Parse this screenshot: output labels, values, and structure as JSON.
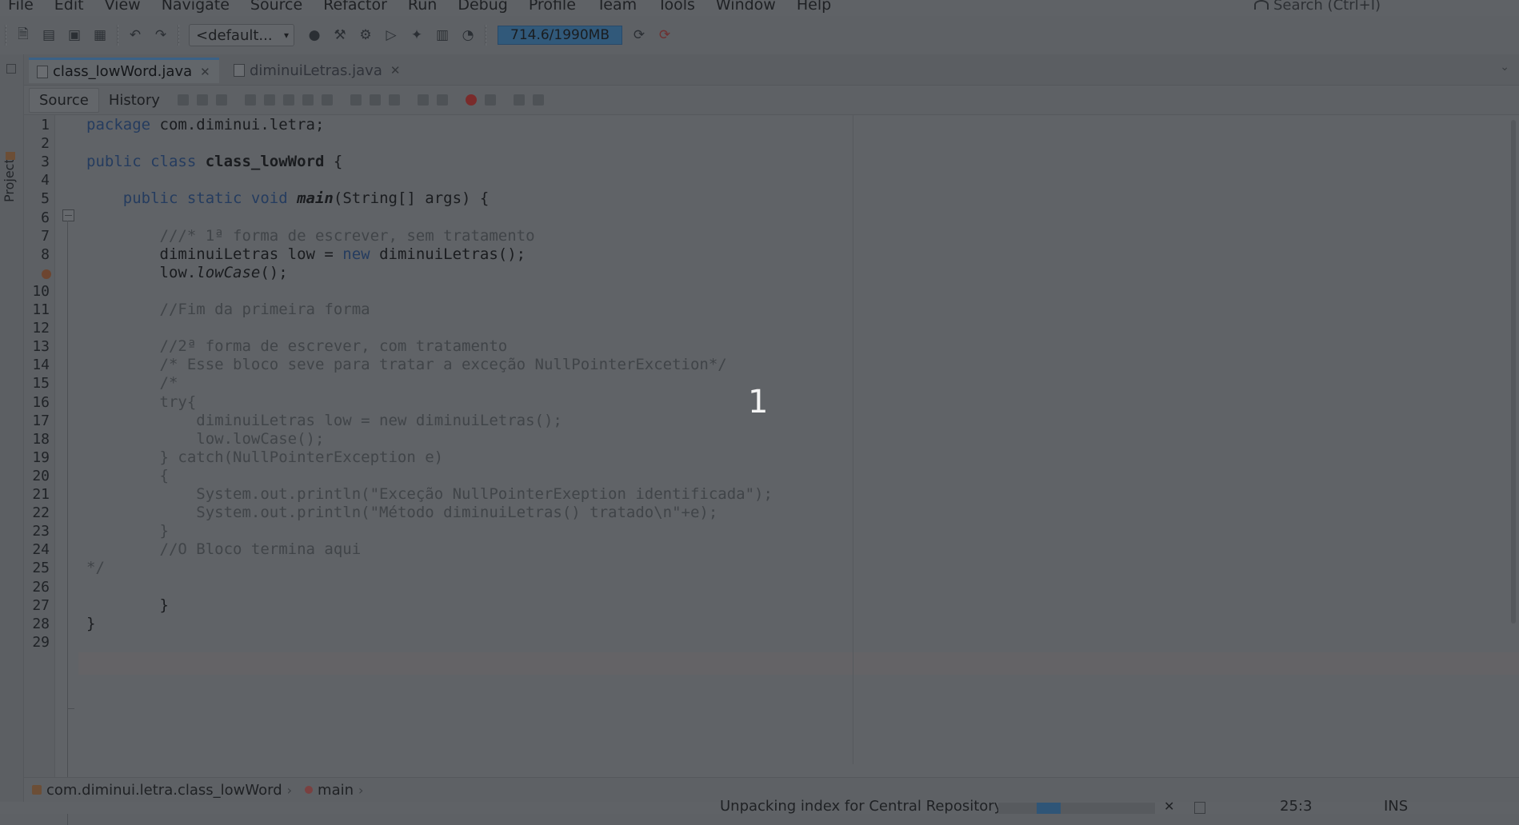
{
  "menu": [
    "File",
    "Edit",
    "View",
    "Navigate",
    "Source",
    "Refactor",
    "Run",
    "Debug",
    "Profile",
    "Team",
    "Tools",
    "Window",
    "Help"
  ],
  "search": {
    "placeholder": "Search (Ctrl+I)"
  },
  "toolbar": {
    "config": "<default...",
    "memory": "714.6/1990MB"
  },
  "sidebar": {
    "projects_label": "Projects"
  },
  "tabs": [
    {
      "label": "class_lowWord.java",
      "active": true
    },
    {
      "label": "diminuiLetras.java",
      "active": false
    }
  ],
  "editor_tabs": {
    "source": "Source",
    "history": "History"
  },
  "code": {
    "lines": [
      {
        "n": "1",
        "t": [
          [
            "kw",
            "package"
          ],
          [
            "txt",
            " com.diminui.letra;"
          ]
        ]
      },
      {
        "n": "2",
        "t": []
      },
      {
        "n": "3",
        "t": [
          [
            "kw",
            "public class "
          ],
          [
            "txt bold",
            "class_lowWord"
          ],
          [
            "txt",
            " {"
          ]
        ]
      },
      {
        "n": "4",
        "t": []
      },
      {
        "n": "5",
        "t": [
          [
            "txt",
            "    "
          ],
          [
            "kw",
            "public static void "
          ],
          [
            "txt bold ital",
            "main"
          ],
          [
            "txt",
            "(String[] args) {"
          ]
        ]
      },
      {
        "n": "6",
        "t": []
      },
      {
        "n": "7",
        "t": [
          [
            "txt",
            "        "
          ],
          [
            "cm",
            "///* 1ª forma de escrever, sem tratamento"
          ]
        ]
      },
      {
        "n": "8",
        "t": [
          [
            "txt",
            "        diminuiLetras low = "
          ],
          [
            "kw",
            "new"
          ],
          [
            "txt",
            " diminuiLetras();"
          ]
        ]
      },
      {
        "n": "",
        "t": [
          [
            "txt",
            "        low."
          ],
          [
            "txt ital",
            "lowCase"
          ],
          [
            "txt",
            "();"
          ]
        ],
        "warn": true
      },
      {
        "n": "10",
        "t": []
      },
      {
        "n": "11",
        "t": [
          [
            "txt",
            "        "
          ],
          [
            "cm",
            "//Fim da primeira forma"
          ]
        ]
      },
      {
        "n": "12",
        "t": []
      },
      {
        "n": "13",
        "t": [
          [
            "txt",
            "        "
          ],
          [
            "cm",
            "//2ª forma de escrever, com tratamento"
          ]
        ]
      },
      {
        "n": "14",
        "t": [
          [
            "txt",
            "        "
          ],
          [
            "cm",
            "/* Esse bloco seve para tratar a exceção NullPointerExcetion*/"
          ]
        ]
      },
      {
        "n": "15",
        "t": [
          [
            "txt",
            "        "
          ],
          [
            "cm",
            "/*"
          ]
        ]
      },
      {
        "n": "16",
        "t": [
          [
            "txt",
            "        "
          ],
          [
            "cm",
            "try{"
          ]
        ]
      },
      {
        "n": "17",
        "t": [
          [
            "txt",
            "            "
          ],
          [
            "cm",
            "diminuiLetras low = new diminuiLetras();"
          ]
        ]
      },
      {
        "n": "18",
        "t": [
          [
            "txt",
            "            "
          ],
          [
            "cm",
            "low.lowCase();"
          ]
        ]
      },
      {
        "n": "19",
        "t": [
          [
            "txt",
            "        "
          ],
          [
            "cm",
            "} catch(NullPointerException e)"
          ]
        ]
      },
      {
        "n": "20",
        "t": [
          [
            "txt",
            "        "
          ],
          [
            "cm",
            "{"
          ]
        ]
      },
      {
        "n": "21",
        "t": [
          [
            "txt",
            "            "
          ],
          [
            "cm",
            "System.out.println(\"Exceção NullPointerExeption identificada\");"
          ]
        ]
      },
      {
        "n": "22",
        "t": [
          [
            "txt",
            "            "
          ],
          [
            "cm",
            "System.out.println(\"Método diminuiLetras() tratado\\n\"+e);"
          ]
        ]
      },
      {
        "n": "23",
        "t": [
          [
            "txt",
            "        "
          ],
          [
            "cm",
            "}"
          ]
        ]
      },
      {
        "n": "24",
        "t": [
          [
            "txt",
            "        "
          ],
          [
            "cm",
            "//O Bloco termina aqui"
          ]
        ]
      },
      {
        "n": "25",
        "t": [
          [
            "cm",
            "*/"
          ]
        ]
      },
      {
        "n": "26",
        "t": []
      },
      {
        "n": "27",
        "t": [
          [
            "txt",
            "        }"
          ]
        ]
      },
      {
        "n": "28",
        "t": [
          [
            "txt",
            "}"
          ]
        ]
      },
      {
        "n": "29",
        "t": []
      }
    ]
  },
  "overlay": {
    "number": "1"
  },
  "breadcrumb": {
    "class_path": "com.diminui.letra.class_lowWord",
    "method": "main"
  },
  "status": {
    "message": "Unpacking index for Central Repository",
    "progress": 0.18,
    "position": "25:3",
    "mode": "INS"
  }
}
